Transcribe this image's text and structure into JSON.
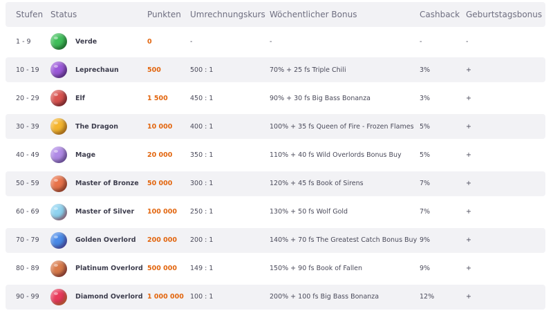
{
  "header": {
    "stufen": "Stufen",
    "status": "Status",
    "punkten": "Punkten",
    "kurs": "Umrechnungskurs",
    "bonus": "Wöchentlicher Bonus",
    "cashback": "Cashback",
    "birthday": "Geburtstagsbonus"
  },
  "rows": [
    {
      "stufen": "1 - 9",
      "status": "Verde",
      "punkten": "0",
      "kurs": "-",
      "bonus": "-",
      "cashback": "-",
      "birthday": "-",
      "icon": "verde-planet-icon",
      "color": "#3fbf5a",
      "color2": "#1f7a2e"
    },
    {
      "stufen": "10 - 19",
      "status": "Leprechaun",
      "punkten": "500",
      "kurs": "500 : 1",
      "bonus": "70% + 25 fs Triple Chili",
      "cashback": "3%",
      "birthday": "+",
      "icon": "leprechaun-planet-icon",
      "color": "#9b59d9",
      "color2": "#5a2a8a"
    },
    {
      "stufen": "20 - 29",
      "status": "Elf",
      "punkten": "1 500",
      "kurs": "450 : 1",
      "bonus": "90% + 30 fs Big Bass Bonanza",
      "cashback": "3%",
      "birthday": "+",
      "icon": "elf-planet-icon",
      "color": "#d9534f",
      "color2": "#7a2030"
    },
    {
      "stufen": "30 - 39",
      "status": "The Dragon",
      "punkten": "10 000",
      "kurs": "400 : 1",
      "bonus": "100% + 35 fs Queen of Fire - Frozen Flames",
      "cashback": "5%",
      "birthday": "+",
      "icon": "dragon-planet-icon",
      "color": "#f5b52e",
      "color2": "#c9701a"
    },
    {
      "stufen": "40 - 49",
      "status": "Mage",
      "punkten": "20 000",
      "kurs": "350 : 1",
      "bonus": "110% + 40 fs Wild Overlords Bonus Buy",
      "cashback": "5%",
      "birthday": "+",
      "icon": "mage-planet-icon",
      "color": "#b08ae6",
      "color2": "#6b4aa8"
    },
    {
      "stufen": "50 - 59",
      "status": "Master of Bronze",
      "punkten": "50 000",
      "kurs": "300 : 1",
      "bonus": "120% + 45 fs Book of Sirens",
      "cashback": "7%",
      "birthday": "+",
      "icon": "bronze-planet-icon",
      "color": "#e8734a",
      "color2": "#9e3a2a"
    },
    {
      "stufen": "60 - 69",
      "status": "Master of Silver",
      "punkten": "100 000",
      "kurs": "250 : 1",
      "bonus": "130% + 50 fs Wolf Gold",
      "cashback": "7%",
      "birthday": "+",
      "icon": "silver-planet-icon",
      "color": "#8fd3f0",
      "color2": "#d9506a"
    },
    {
      "stufen": "70 - 79",
      "status": "Golden Overlord",
      "punkten": "200 000",
      "kurs": "200 : 1",
      "bonus": "140% + 70 fs The Greatest Catch Bonus Buy",
      "cashback": "9%",
      "birthday": "+",
      "icon": "golden-planet-icon",
      "color": "#4a8ae8",
      "color2": "#6a3ab0"
    },
    {
      "stufen": "80 - 89",
      "status": "Platinum Overlord",
      "punkten": "500 000",
      "kurs": "149 : 1",
      "bonus": "150% + 90 fs Book of Fallen",
      "cashback": "9%",
      "birthday": "+",
      "icon": "platinum-planet-icon",
      "color": "#d97a4a",
      "color2": "#8a2a3a"
    },
    {
      "stufen": "90 - 99",
      "status": "Diamond Overlord",
      "punkten": "1 000 000",
      "kurs": "100 : 1",
      "bonus": "200% + 100 fs Big Bass Bonanza",
      "cashback": "12%",
      "birthday": "+",
      "icon": "diamond-planet-icon",
      "color": "#e83a5a",
      "color2": "#f0a030"
    }
  ]
}
